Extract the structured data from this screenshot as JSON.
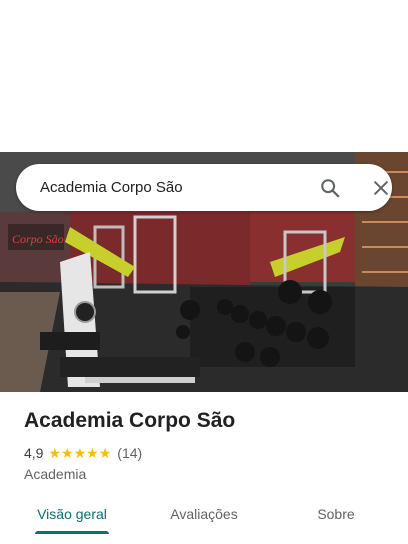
{
  "search": {
    "query": "Academia Corpo São"
  },
  "icons": {
    "search": "search-icon",
    "close": "close-icon",
    "star": "star-icon"
  },
  "place": {
    "name": "Academia Corpo São",
    "rating": "4,9",
    "rating_value": 4.9,
    "stars_filled": 5,
    "reviews": "(14)",
    "category": "Academia",
    "photo_sign": "Corpo São"
  },
  "tabs": [
    {
      "label": "Visão geral",
      "active": true
    },
    {
      "label": "Avaliações",
      "active": false
    },
    {
      "label": "Sobre",
      "active": false
    }
  ],
  "colors": {
    "accent": "#0b6e75",
    "star": "#fbbc04",
    "text": "#202124",
    "muted": "#5f6368"
  }
}
